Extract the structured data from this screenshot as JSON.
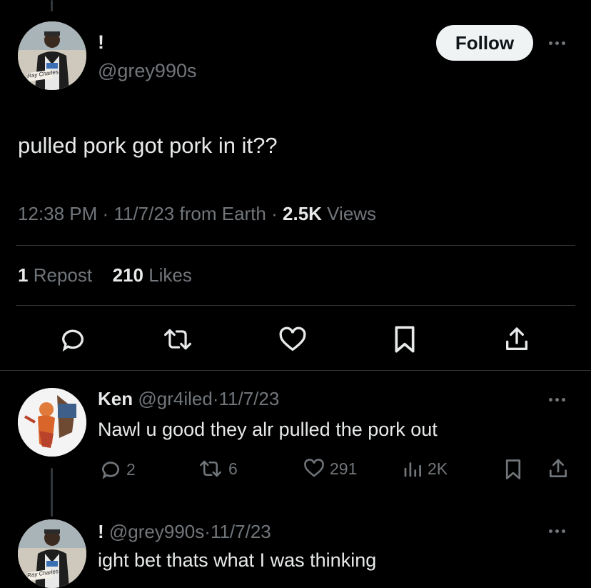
{
  "main_tweet": {
    "display_name": "!",
    "handle": "@grey990s",
    "follow_label": "Follow",
    "text": "pulled pork got pork in it??",
    "time": "12:38 PM",
    "date": "11/7/23",
    "source": "from Earth",
    "views_count": "2.5K",
    "views_label": "Views",
    "reposts_count": "1",
    "reposts_label": "Repost",
    "likes_count": "210",
    "likes_label": "Likes",
    "avatar_caption": "Ray Charles"
  },
  "replies": [
    {
      "display_name": "Ken",
      "handle": "@gr4iled",
      "date": "11/7/23",
      "text": "Nawl u good they alr pulled the pork out",
      "replies": "2",
      "reposts": "6",
      "likes": "291",
      "views": "2K"
    },
    {
      "display_name": "!",
      "handle": "@grey990s",
      "date": "11/7/23",
      "text": "ight bet thats what I was thinking",
      "avatar_caption": "Ray Charles"
    }
  ],
  "separator": "·",
  "colors": {
    "background": "#000000",
    "text": "#e7e9ea",
    "muted": "#71767b",
    "divider": "#2f3336",
    "follow_bg": "#eff3f4"
  }
}
